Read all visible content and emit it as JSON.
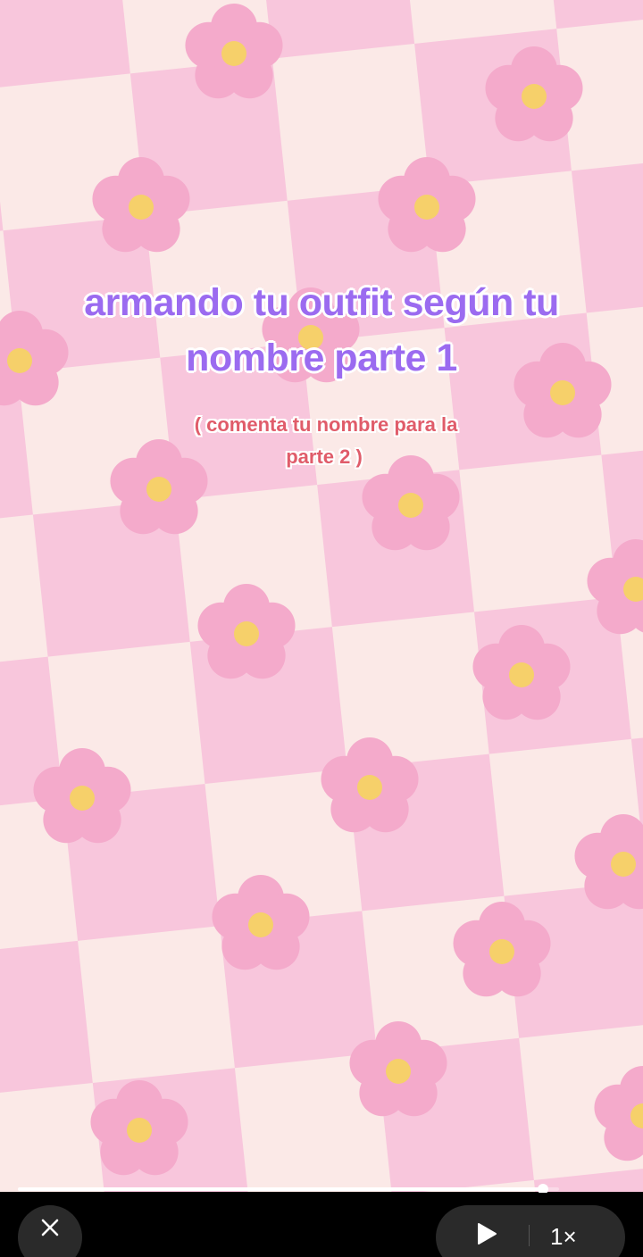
{
  "overlay": {
    "title_lines": [
      "armando  tu outfit según tu",
      "nombre parte 1"
    ],
    "subtitle_lines": [
      "( comenta tu nombre para la",
      "parte 2 )"
    ]
  },
  "colors": {
    "pink_tile": "#f8c6dc",
    "cream_tile": "#fbe9e7",
    "flower_petal": "#f4aacb",
    "flower_center": "#f6d06a",
    "title_text": "#9b6bf0",
    "subtitle_text": "#e05c6a"
  },
  "player": {
    "progress": 0.97,
    "playback_speed": "1×",
    "icons": {
      "close": "close-icon",
      "play": "play-icon"
    }
  }
}
